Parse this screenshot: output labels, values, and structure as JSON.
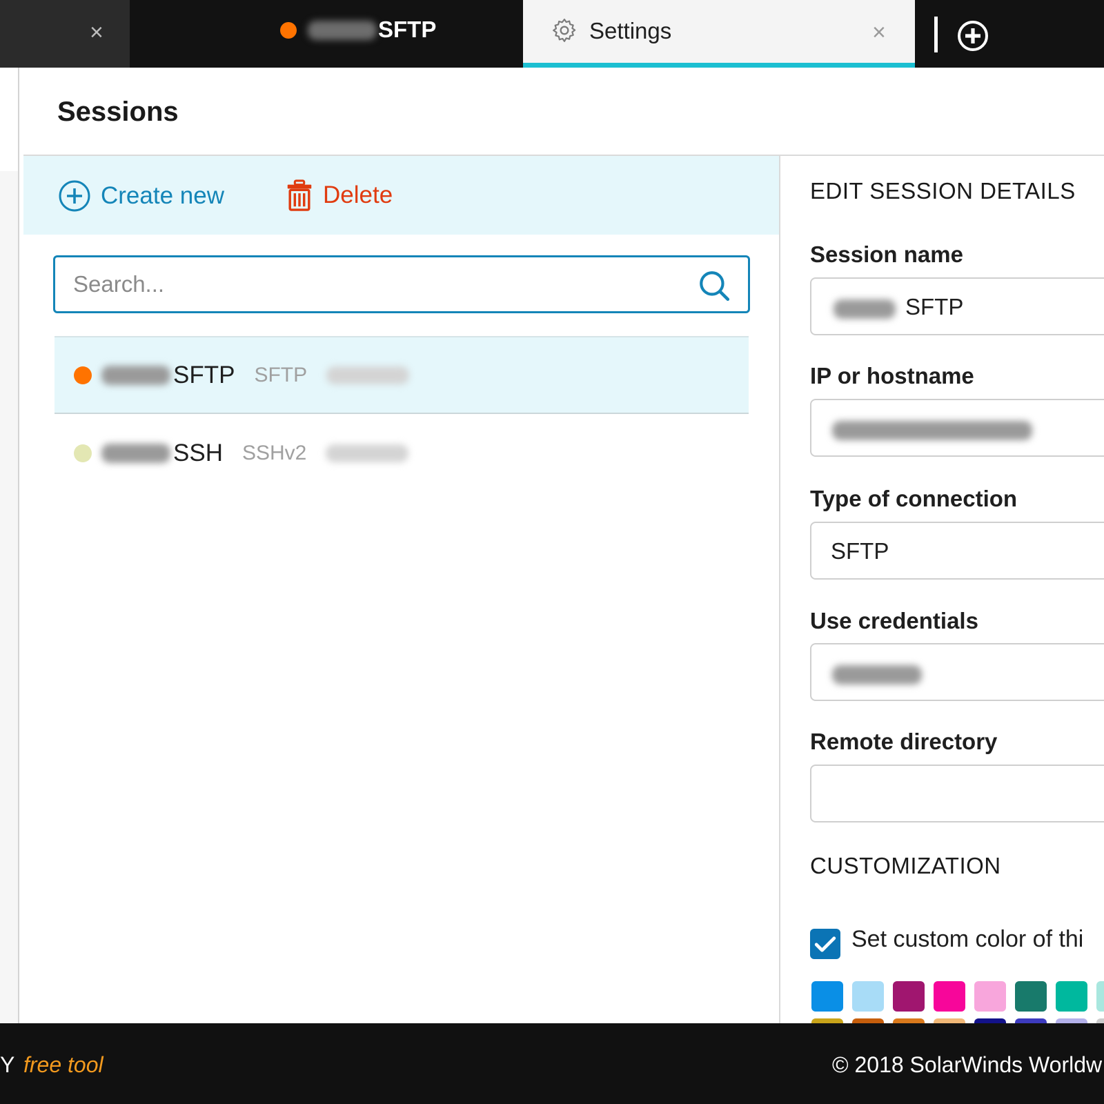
{
  "tabs": [
    {
      "label": "",
      "close": "×"
    },
    {
      "label": "SFTP",
      "status_color": "#ff7300"
    },
    {
      "label": "Settings",
      "icon": "gear-icon",
      "close": "×",
      "active": true
    }
  ],
  "new_tab_icon": "plus-circle-icon",
  "page": {
    "title": "Sessions"
  },
  "toolbar": {
    "create_label": "Create new",
    "create_icon": "plus-circle-icon",
    "delete_label": "Delete",
    "delete_icon": "trash-icon"
  },
  "search": {
    "placeholder": "Search...",
    "value": "",
    "icon": "search-icon"
  },
  "sessions": [
    {
      "name": "SFTP",
      "protocol": "SFTP",
      "status_color": "#ff7300",
      "selected": true
    },
    {
      "name": "SSH",
      "protocol": "SSHv2",
      "status_color": "#e3e7b3",
      "selected": false
    }
  ],
  "details": {
    "section_title": "EDIT SESSION DETAILS",
    "session_name_label": "Session name",
    "session_name_value": "SFTP",
    "host_label": "IP or hostname",
    "host_value": "",
    "connection_label": "Type of connection",
    "connection_value": "SFTP",
    "credentials_label": "Use credentials",
    "credentials_value": "",
    "remote_dir_label": "Remote directory",
    "remote_dir_value": ""
  },
  "customization": {
    "title": "CUSTOMIZATION",
    "custom_color_label": "Set custom color of thi",
    "custom_color_checked": true,
    "colors": [
      "#0a8fe6",
      "#a8dcf7",
      "#a0166f",
      "#f7069a",
      "#f8a6dc",
      "#187a6b",
      "#00b89e",
      "#a9e7df"
    ],
    "colors_row2": [
      "#c9a41a",
      "#c65e0c",
      "#d9791c",
      "#f1b878",
      "#13128a",
      "#3d3bbf",
      "#b4b1ea",
      "#cccccc"
    ]
  },
  "footer": {
    "brand": "Y",
    "free_tool": "free tool",
    "copyright": "© 2018 SolarWinds Worldw"
  }
}
